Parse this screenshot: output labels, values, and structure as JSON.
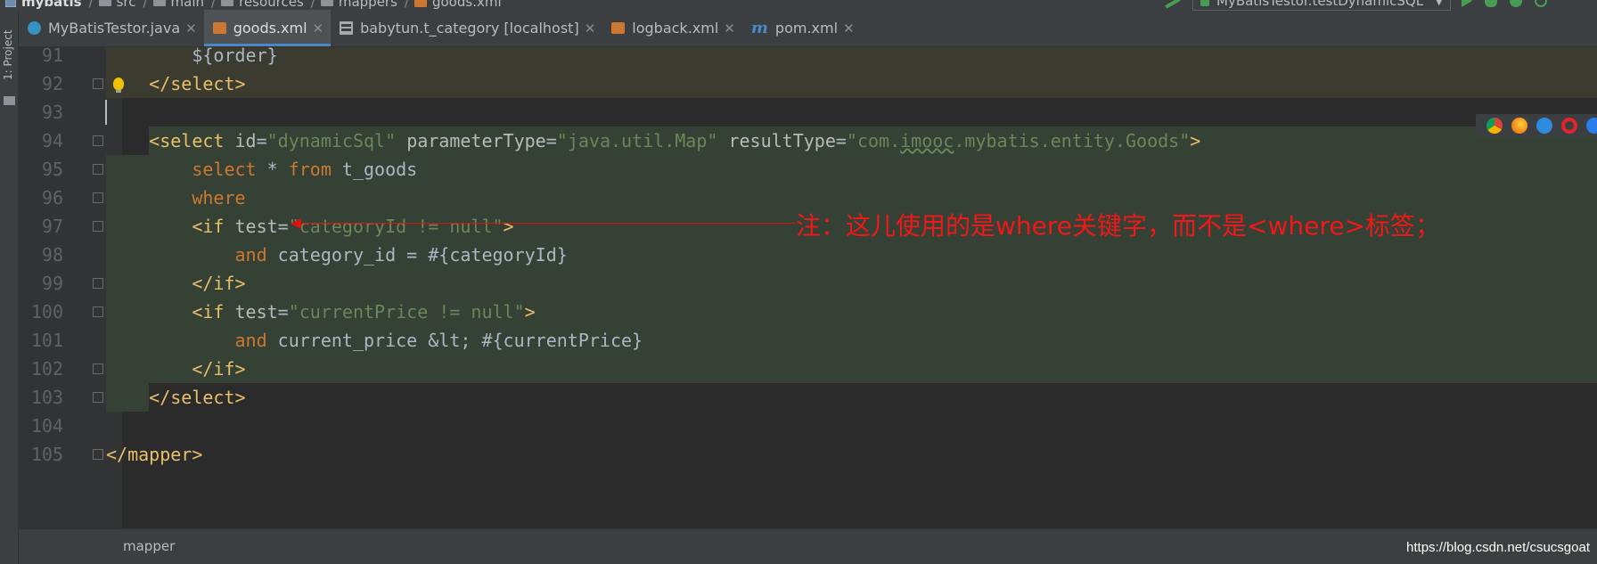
{
  "breadcrumb": {
    "module": "mybatis",
    "items": [
      "src",
      "main",
      "resources",
      "mappers",
      "goods.xml"
    ]
  },
  "run_config": {
    "label": "MyBatisTestor.testDynamicSQL"
  },
  "side_strip": {
    "label": "1: Project"
  },
  "tabs": [
    {
      "label": "MyBatisTestor.java",
      "icon": "java-class-icon",
      "closable": true,
      "active": false
    },
    {
      "label": "goods.xml",
      "icon": "xml-file-icon",
      "closable": true,
      "active": true
    },
    {
      "label": "babytun.t_category [localhost]",
      "icon": "db-table-icon",
      "closable": true,
      "active": false
    },
    {
      "label": "logback.xml",
      "icon": "xml-file-icon",
      "closable": true,
      "active": false
    },
    {
      "label": "pom.xml",
      "icon": "maven-icon",
      "closable": true,
      "active": false
    }
  ],
  "editor": {
    "lines": [
      {
        "n": "91",
        "segments": [
          [
            "plain",
            "        ${order}"
          ]
        ]
      },
      {
        "n": "92",
        "segments": [
          [
            "tag",
            "    </select>"
          ]
        ]
      },
      {
        "n": "93",
        "segments": [
          [
            "plain",
            ""
          ]
        ]
      },
      {
        "n": "94",
        "segments": [
          [
            "tag",
            "    <select "
          ],
          [
            "attr",
            "id"
          ],
          [
            "plain",
            "="
          ],
          [
            "str",
            "\"dynamicSql\""
          ],
          [
            "plain",
            " "
          ],
          [
            "attr",
            "parameterType"
          ],
          [
            "plain",
            "="
          ],
          [
            "str",
            "\"java.util.Map\""
          ],
          [
            "plain",
            " "
          ],
          [
            "attr",
            "resultType"
          ],
          [
            "plain",
            "="
          ],
          [
            "str",
            "\"com.imooc.mybatis.entity.Goods\""
          ],
          [
            "tag",
            ">"
          ]
        ]
      },
      {
        "n": "95",
        "segments": [
          [
            "plain",
            "        "
          ],
          [
            "kw",
            "select"
          ],
          [
            "plain",
            " * "
          ],
          [
            "kw",
            "from"
          ],
          [
            "plain",
            " t_goods"
          ]
        ]
      },
      {
        "n": "96",
        "segments": [
          [
            "plain",
            "        "
          ],
          [
            "kw",
            "where"
          ]
        ]
      },
      {
        "n": "97",
        "segments": [
          [
            "tag",
            "        <if "
          ],
          [
            "attr",
            "test"
          ],
          [
            "plain",
            "="
          ],
          [
            "str",
            "\"categoryId != null\""
          ],
          [
            "tag",
            ">"
          ]
        ]
      },
      {
        "n": "98",
        "segments": [
          [
            "plain",
            "            "
          ],
          [
            "kw",
            "and"
          ],
          [
            "plain",
            " category_id = #{categoryId}"
          ]
        ]
      },
      {
        "n": "99",
        "segments": [
          [
            "tag",
            "        </if>"
          ]
        ]
      },
      {
        "n": "100",
        "segments": [
          [
            "tag",
            "        <if "
          ],
          [
            "attr",
            "test"
          ],
          [
            "plain",
            "="
          ],
          [
            "str",
            "\"currentPrice != null\""
          ],
          [
            "tag",
            ">"
          ]
        ]
      },
      {
        "n": "101",
        "segments": [
          [
            "plain",
            "            "
          ],
          [
            "kw",
            "and"
          ],
          [
            "plain",
            " current_price &lt; #{currentPrice}"
          ]
        ]
      },
      {
        "n": "102",
        "segments": [
          [
            "tag",
            "        </if>"
          ]
        ]
      },
      {
        "n": "103",
        "segments": [
          [
            "tag",
            "    </select>"
          ]
        ]
      },
      {
        "n": "104",
        "segments": [
          [
            "plain",
            ""
          ]
        ]
      },
      {
        "n": "105",
        "segments": [
          [
            "tag",
            "</mapper>"
          ]
        ]
      }
    ],
    "colors": {
      "tag": "#e8bf6a",
      "attr": "#bababa",
      "string": "#6a8759",
      "keyword": "#cc7832",
      "plain": "#a9b7c6",
      "current_stmt_bg": "#344134",
      "prev_stmt_bg": "#3b3b2f"
    }
  },
  "annotation": {
    "text": "注：这儿使用的是where关键字，而不是<where>标签；",
    "color": "#f01818"
  },
  "status": {
    "breadcrumb": "mapper"
  },
  "watermark": "https://blog.csdn.net/csucsgoat"
}
